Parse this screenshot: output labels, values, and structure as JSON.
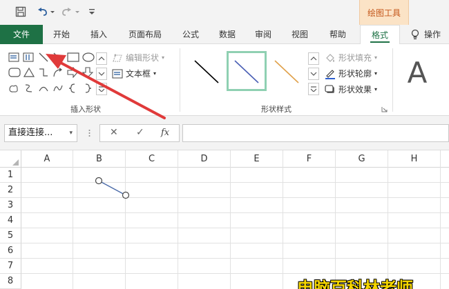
{
  "quick_access": {
    "icons": [
      "save-icon",
      "undo-icon",
      "redo-icon",
      "customize-icon"
    ]
  },
  "context_tab_group": "绘图工具",
  "tabs": [
    {
      "label": "文件"
    },
    {
      "label": "开始"
    },
    {
      "label": "插入"
    },
    {
      "label": "页面布局"
    },
    {
      "label": "公式"
    },
    {
      "label": "数据"
    },
    {
      "label": "审阅"
    },
    {
      "label": "视图"
    },
    {
      "label": "帮助"
    },
    {
      "label": "格式"
    }
  ],
  "help_tab": {
    "label": "操作"
  },
  "ribbon": {
    "insert_shapes": {
      "label": "插入形状",
      "edit_shape": "编辑形状",
      "text_box": "文本框"
    },
    "shape_styles": {
      "label": "形状样式",
      "fill": "形状填充",
      "outline": "形状轮廓",
      "effects": "形状效果",
      "style_colors": [
        "#000000",
        "#4a5fb5",
        "#e0a14a"
      ]
    },
    "art_text_glyph": "A"
  },
  "formula_bar": {
    "name_box": "直接连接...",
    "cancel_glyph": "✕",
    "confirm_glyph": "✓",
    "fx_label": "fx",
    "value": ""
  },
  "sheet": {
    "columns": [
      "A",
      "B",
      "C",
      "D",
      "E",
      "F",
      "G",
      "H"
    ],
    "rows": [
      "1",
      "2",
      "3",
      "4",
      "5",
      "6",
      "7",
      "8"
    ]
  },
  "annotation": {
    "arrow_color": "#e03a3a"
  },
  "watermark": "电脑百科林老师"
}
